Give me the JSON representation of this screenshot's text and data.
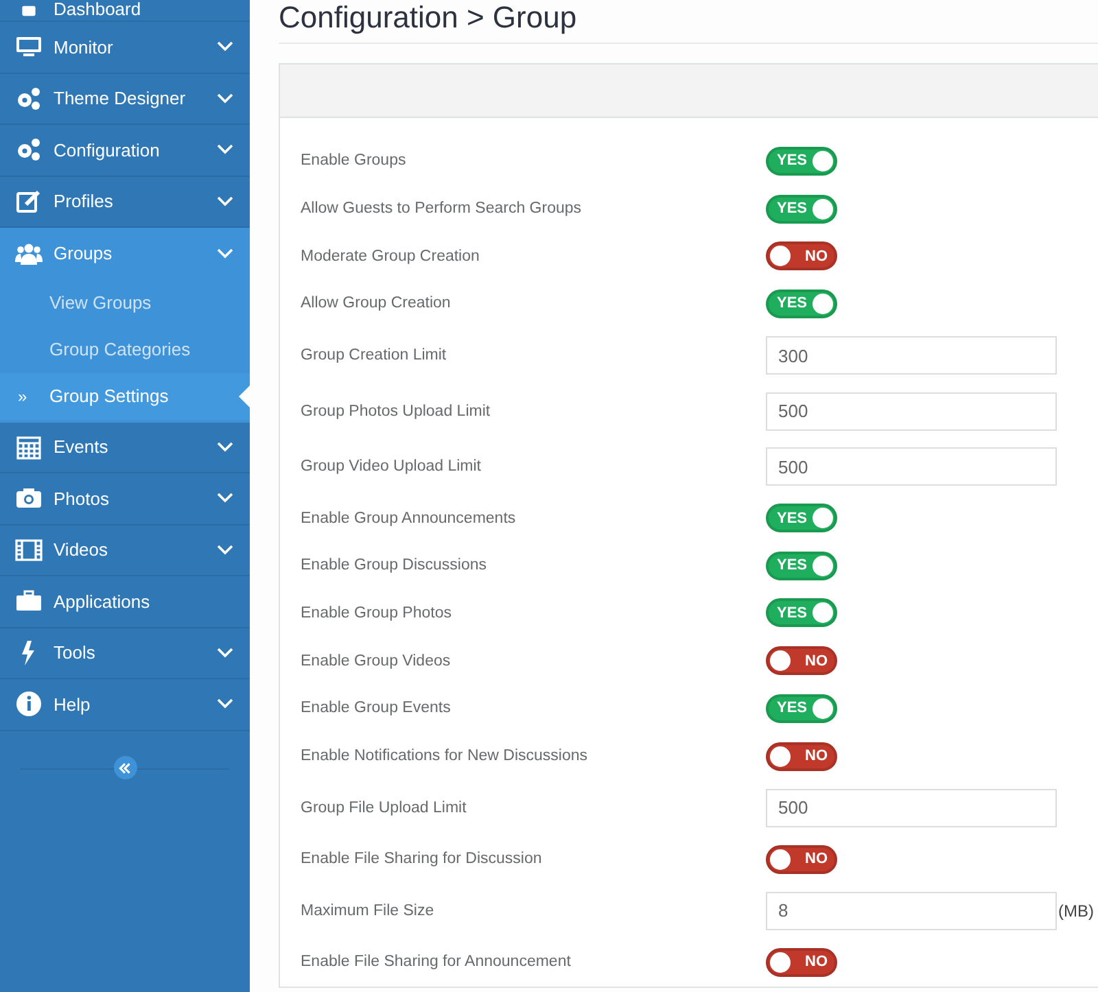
{
  "sidebar": {
    "items": [
      {
        "label": "Dashboard",
        "has_submenu": false,
        "expanded": false
      },
      {
        "label": "Monitor",
        "has_submenu": true,
        "expanded": false
      },
      {
        "label": "Theme Designer",
        "has_submenu": true,
        "expanded": false
      },
      {
        "label": "Configuration",
        "has_submenu": true,
        "expanded": false
      },
      {
        "label": "Profiles",
        "has_submenu": true,
        "expanded": false
      },
      {
        "label": "Groups",
        "has_submenu": true,
        "expanded": true,
        "children": [
          {
            "label": "View Groups",
            "selected": false
          },
          {
            "label": "Group Categories",
            "selected": false
          },
          {
            "label": "Group Settings",
            "selected": true,
            "marker": "»"
          }
        ]
      },
      {
        "label": "Events",
        "has_submenu": true,
        "expanded": false
      },
      {
        "label": "Photos",
        "has_submenu": true,
        "expanded": false
      },
      {
        "label": "Videos",
        "has_submenu": true,
        "expanded": false
      },
      {
        "label": "Applications",
        "has_submenu": false,
        "expanded": false
      },
      {
        "label": "Tools",
        "has_submenu": true,
        "expanded": false
      },
      {
        "label": "Help",
        "has_submenu": true,
        "expanded": false
      }
    ]
  },
  "page": {
    "title": "Configuration > Group"
  },
  "settings": [
    {
      "kind": "toggle",
      "label": "Enable Groups",
      "on": true,
      "text": "YES"
    },
    {
      "kind": "toggle",
      "label": "Allow Guests to Perform Search Groups",
      "on": true,
      "text": "YES"
    },
    {
      "kind": "toggle",
      "label": "Moderate Group Creation",
      "on": false,
      "text": "NO"
    },
    {
      "kind": "toggle",
      "label": "Allow Group Creation",
      "on": true,
      "text": "YES"
    },
    {
      "kind": "input",
      "label": "Group Creation Limit",
      "value": "300"
    },
    {
      "kind": "input",
      "label": "Group Photos Upload Limit",
      "value": "500"
    },
    {
      "kind": "input",
      "label": "Group Video Upload Limit",
      "value": "500"
    },
    {
      "kind": "toggle",
      "label": "Enable Group Announcements",
      "on": true,
      "text": "YES"
    },
    {
      "kind": "toggle",
      "label": "Enable Group Discussions",
      "on": true,
      "text": "YES"
    },
    {
      "kind": "toggle",
      "label": "Enable Group Photos",
      "on": true,
      "text": "YES"
    },
    {
      "kind": "toggle",
      "label": "Enable Group Videos",
      "on": false,
      "text": "NO"
    },
    {
      "kind": "toggle",
      "label": "Enable Group Events",
      "on": true,
      "text": "YES"
    },
    {
      "kind": "toggle",
      "label": "Enable Notifications for New Discussions",
      "on": false,
      "text": "NO"
    },
    {
      "kind": "input",
      "label": "Group File Upload Limit",
      "value": "500"
    },
    {
      "kind": "toggle",
      "label": "Enable File Sharing for Discussion",
      "on": false,
      "text": "NO"
    },
    {
      "kind": "input",
      "label": "Maximum File Size",
      "value": "8",
      "unit": "(MB)"
    },
    {
      "kind": "toggle",
      "label": "Enable File Sharing for Announcement",
      "on": false,
      "text": "NO"
    }
  ]
}
